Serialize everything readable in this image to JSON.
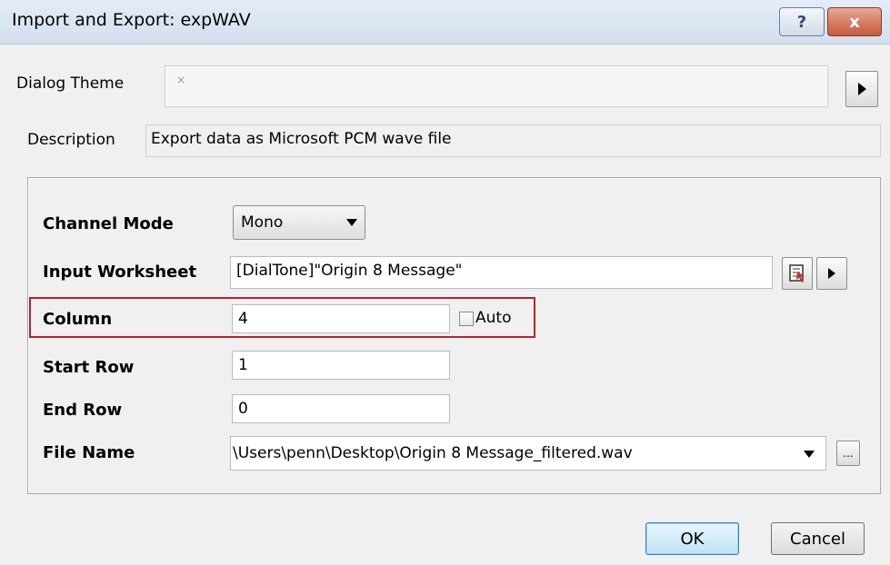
{
  "window": {
    "title": "Import and Export: expWAV"
  },
  "titlebar_buttons": {
    "help": "?",
    "close": "x"
  },
  "dialog_theme": {
    "label": "Dialog Theme",
    "value": "×"
  },
  "description": {
    "label": "Description",
    "value": "Export data as Microsoft PCM wave file"
  },
  "fields": {
    "channel_mode": {
      "label": "Channel Mode",
      "value": "Mono"
    },
    "input_worksheet": {
      "label": "Input Worksheet",
      "value": "[DialTone]\"Origin 8 Message\""
    },
    "column": {
      "label": "Column",
      "value": "4",
      "auto_label": "Auto",
      "auto_checked": false
    },
    "start_row": {
      "label": "Start Row",
      "value": "1"
    },
    "end_row": {
      "label": "End Row",
      "value": "0"
    },
    "file_name": {
      "label": "File Name",
      "value": "\\Users\\penn\\Desktop\\Origin 8 Message_filtered.wav",
      "browse_label": "..."
    }
  },
  "buttons": {
    "ok": "OK",
    "cancel": "Cancel"
  },
  "icons": {
    "arrow": "right-arrow-icon",
    "select_worksheet": "select-worksheet-icon",
    "dropdown": "chevron-down-icon"
  },
  "colors": {
    "highlight": "#b5232e",
    "title_bg": "#d9e4f2"
  }
}
